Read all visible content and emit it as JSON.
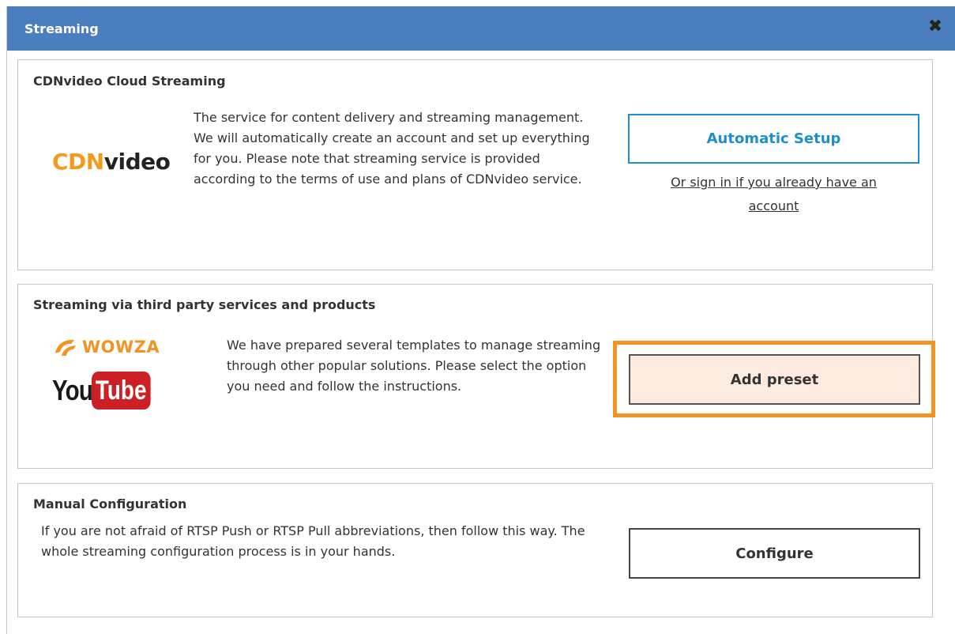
{
  "dialog": {
    "title": "Streaming",
    "close_glyph": "✖"
  },
  "cdn": {
    "heading": "CDNvideo Cloud Streaming",
    "logo_prefix": "CDN",
    "logo_suffix": "video",
    "description": "The service for content delivery and streaming management. We will automatically create an account and set up everything for you. Please note that streaming service is provided according to the terms of use and plans of CDNvideo service.",
    "button_label": "Automatic Setup",
    "signin_line1": "Or sign in if you already have an",
    "signin_line2": "account"
  },
  "third_party": {
    "heading": "Streaming via third party services and products",
    "wowza_label": "WOWZA",
    "youtube_you": "You",
    "youtube_tube": "Tube",
    "description": "We have prepared several templates to manage streaming through other popular solutions. Please select the option you need and follow the instructions.",
    "button_label": "Add preset"
  },
  "manual": {
    "heading": "Manual Configuration",
    "description": "If you are not afraid of RTSP Push or RTSP Pull abbreviations, then follow this way. The whole streaming configuration process is in your hands.",
    "button_label": "Configure"
  },
  "colors": {
    "titlebar": "#4a7ebf",
    "accent_blue": "#1d8fd0",
    "highlight_orange": "#f39322",
    "preset_fill": "#fdebe0"
  }
}
